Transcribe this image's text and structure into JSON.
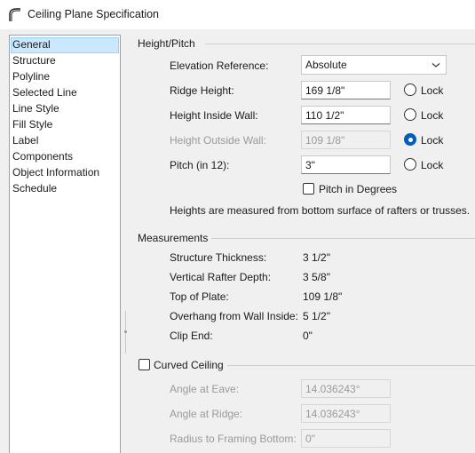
{
  "window": {
    "title": "Ceiling Plane Specification"
  },
  "sidebar": {
    "items": [
      {
        "label": "General",
        "selected": true
      },
      {
        "label": "Structure"
      },
      {
        "label": "Polyline"
      },
      {
        "label": "Selected Line"
      },
      {
        "label": "Line Style"
      },
      {
        "label": "Fill Style"
      },
      {
        "label": "Label"
      },
      {
        "label": "Components"
      },
      {
        "label": "Object Information"
      },
      {
        "label": "Schedule"
      }
    ]
  },
  "height_pitch": {
    "header": "Height/Pitch",
    "elevation_reference": {
      "label": "Elevation Reference:",
      "value": "Absolute"
    },
    "ridge_height": {
      "label": "Ridge Height:",
      "value": "169 1/8\"",
      "lock_label": "Lock",
      "locked": false
    },
    "height_inside_wall": {
      "label": "Height Inside Wall:",
      "value": "110 1/2\"",
      "lock_label": "Lock",
      "locked": false
    },
    "height_outside_wall": {
      "label": "Height Outside Wall:",
      "value": "109 1/8\"",
      "lock_label": "Lock",
      "locked": true
    },
    "pitch": {
      "label": "Pitch (in 12):",
      "value": "3\"",
      "lock_label": "Lock",
      "locked": false
    },
    "pitch_in_degrees": {
      "label": "Pitch in Degrees",
      "checked": false
    },
    "note": "Heights are measured from bottom surface of rafters or trusses."
  },
  "measurements": {
    "header": "Measurements",
    "rows": [
      {
        "label": "Structure Thickness:",
        "value": "3 1/2\""
      },
      {
        "label": "Vertical Rafter Depth:",
        "value": "3 5/8\""
      },
      {
        "label": "Top of Plate:",
        "value": "109 1/8\""
      },
      {
        "label": "Overhang from Wall Inside:",
        "value": "5 1/2\""
      },
      {
        "label": "Clip End:",
        "value": "0\""
      }
    ]
  },
  "curved_ceiling": {
    "label": "Curved Ceiling",
    "checked": false,
    "angle_at_eave": {
      "label": "Angle at Eave:",
      "value": "14.036243°"
    },
    "angle_at_ridge": {
      "label": "Angle at Ridge:",
      "value": "14.036243°"
    },
    "radius_to_framing_bottom": {
      "label": "Radius to Framing Bottom:",
      "value": "0\""
    }
  },
  "colors": {
    "accent": "#005fb8",
    "selection": "#cce8ff",
    "disabled_text": "#9a9a9a"
  }
}
